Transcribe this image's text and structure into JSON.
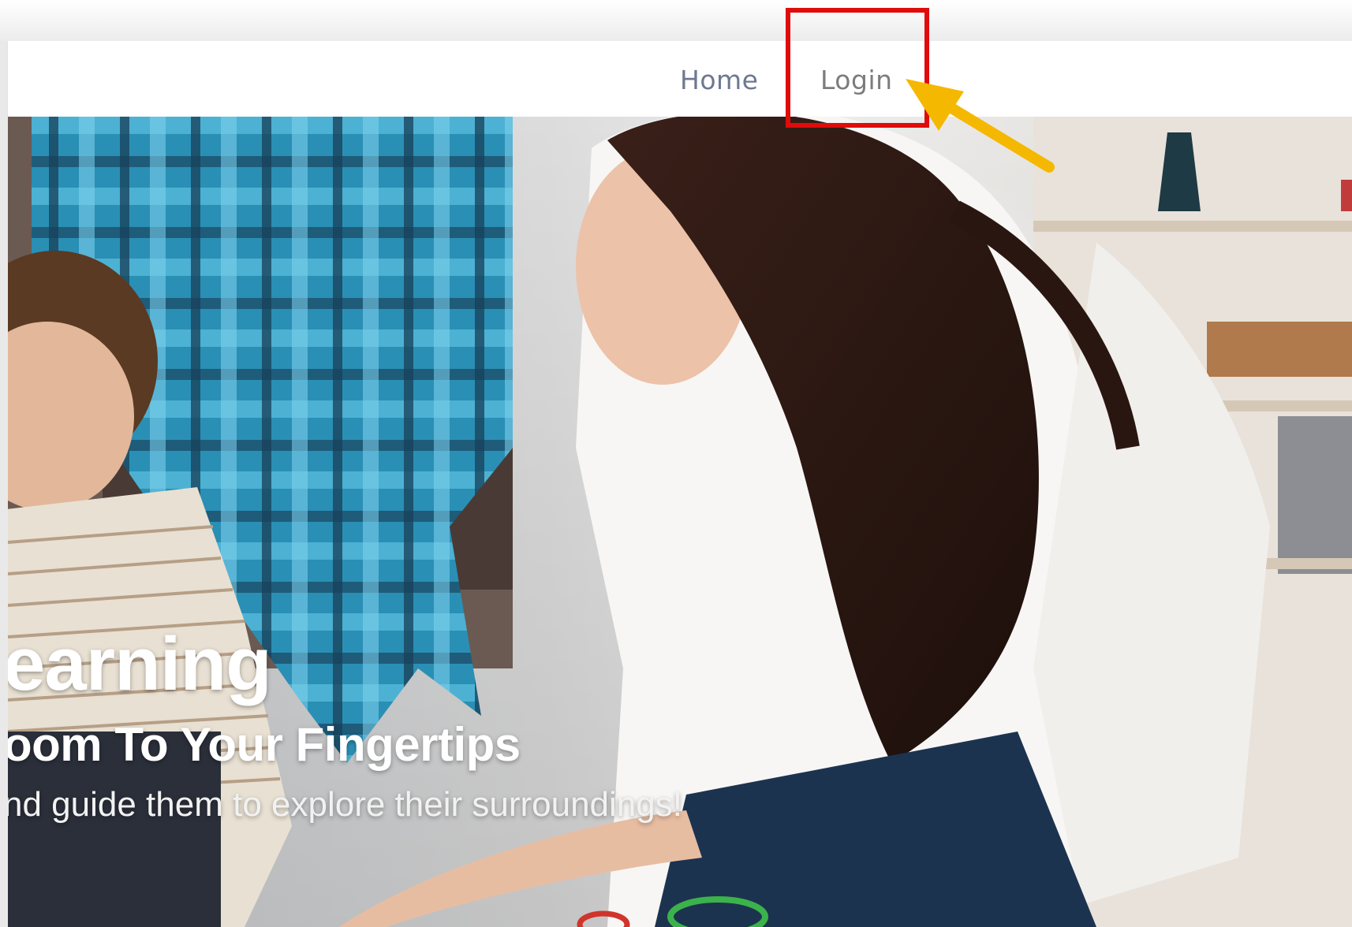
{
  "nav": {
    "home_label": "Home",
    "login_label": "Login"
  },
  "hero": {
    "title": "earning",
    "subtitle": "oom To Your Fingertips",
    "tagline": "nd guide them to explore their surroundings!"
  },
  "annotation": {
    "box_color": "#e00b0b",
    "arrow_color": "#f5b800"
  }
}
